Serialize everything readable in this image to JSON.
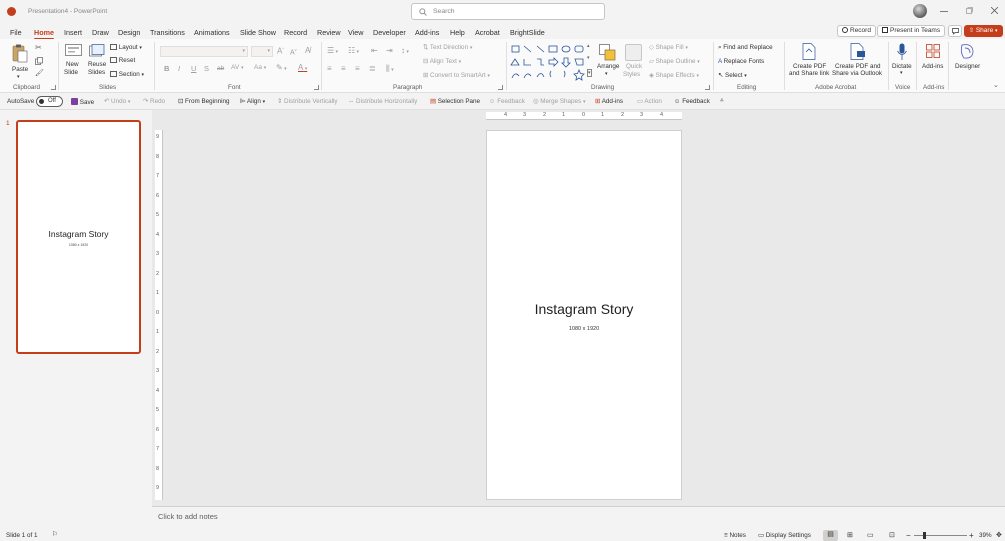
{
  "titlebar": {
    "doc_title": "Presentation4",
    "app_name": "PowerPoint",
    "title_sep": "-",
    "search_placeholder": "Search"
  },
  "menu": {
    "tabs": [
      "File",
      "Home",
      "Insert",
      "Draw",
      "Design",
      "Transitions",
      "Animations",
      "Slide Show",
      "Record",
      "Review",
      "View",
      "Developer",
      "Add-ins",
      "Help",
      "Acrobat",
      "BrightSlide"
    ],
    "active_tab": "Home",
    "record_label": "Record",
    "present_teams_label": "Present in Teams",
    "share_label": "Share"
  },
  "ribbon": {
    "clipboard": {
      "label": "Clipboard",
      "paste": "Paste"
    },
    "slides": {
      "label": "Slides",
      "new_slide_1": "New",
      "new_slide_2": "Slide",
      "reuse_1": "Reuse",
      "reuse_2": "Slides",
      "layout": "Layout",
      "reset": "Reset",
      "section": "Section"
    },
    "font": {
      "label": "Font",
      "bold": "B",
      "italic": "I",
      "underline": "U",
      "strike": "S",
      "ab": "ab",
      "av": "AV",
      "aa": "Aa",
      "grow": "A",
      "shrink": "A"
    },
    "paragraph": {
      "label": "Paragraph",
      "text_direction": "Text Direction",
      "align_text": "Align Text",
      "convert_smartart": "Convert to SmartArt"
    },
    "drawing": {
      "label": "Drawing",
      "arrange": "Arrange",
      "quick_styles_1": "Quick",
      "quick_styles_2": "Styles",
      "shape_fill": "Shape Fill",
      "shape_outline": "Shape Outline",
      "shape_effects": "Shape Effects"
    },
    "editing": {
      "label": "Editing",
      "find_replace": "Find and Replace",
      "replace_fonts": "Replace Fonts",
      "select": "Select"
    },
    "acrobat": {
      "label": "Adobe Acrobat",
      "create_pdf_1": "Create PDF",
      "create_pdf_2": "and Share link",
      "create_outlook_1": "Create PDF and",
      "create_outlook_2": "Share via Outlook"
    },
    "voice": {
      "label": "Voice",
      "dictate": "Dictate"
    },
    "addins": {
      "label": "Add-ins",
      "addins_btn": "Add-ins"
    },
    "designer": {
      "label": "Designer"
    }
  },
  "qat": {
    "autosave": "AutoSave",
    "toggle": "Off",
    "save": "Save",
    "undo": "Undo",
    "redo": "Redo",
    "from_beginning": "From Beginning",
    "align": "Align",
    "distribute_v": "Distribute Vertically",
    "distribute_h": "Distribute Horizontally",
    "selection_pane": "Selection Pane",
    "feedback_dim": "Feedback",
    "merge_shapes": "Merge Shapes",
    "addins": "Add-ins",
    "action": "Action",
    "feedback": "Feedback"
  },
  "thumbnails": [
    {
      "number": "1",
      "title": "Instagram Story",
      "subtitle": "1080 x 1920"
    }
  ],
  "slide": {
    "title": "Instagram Story",
    "subtitle": "1080 x 1920"
  },
  "ruler": {
    "h_ticks": [
      "4",
      "3",
      "2",
      "1",
      "0",
      "1",
      "2",
      "3",
      "4"
    ],
    "v_ticks": [
      "9",
      "8",
      "7",
      "6",
      "5",
      "4",
      "3",
      "2",
      "1",
      "0",
      "1",
      "2",
      "3",
      "4",
      "5",
      "6",
      "7",
      "8",
      "9"
    ]
  },
  "notes": {
    "placeholder": "Click to add notes"
  },
  "status": {
    "slide_count": "Slide 1 of 1",
    "notes": "Notes",
    "display_settings": "Display Settings",
    "zoom": "39%",
    "zoom_minus": "−",
    "zoom_plus": "+"
  },
  "colors": {
    "accent": "#c43e1c",
    "share_bg": "#c43e1c",
    "slide_border": "#c43e1c"
  }
}
